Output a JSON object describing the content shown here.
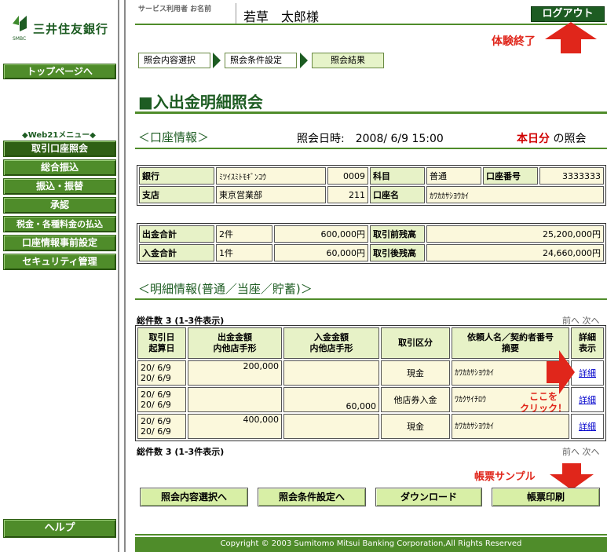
{
  "bank": {
    "name": "三井住友銀行",
    "abbr": "SMBC"
  },
  "nav": {
    "top_page": "トップページへ",
    "menu_title": "◆Web21メニュー◆",
    "items": [
      "取引口座照会",
      "総合振込",
      "振込・振替",
      "承認",
      "税金・各種料金の払込",
      "口座情報事前設定",
      "セキュリティ管理"
    ],
    "help": "ヘルプ"
  },
  "header": {
    "user_label": "サービス利用者 お名前",
    "user_name": "若草　太郎様",
    "logout": "ログアウト"
  },
  "annotations": {
    "end": "体験終了",
    "click_here": "ここを\nクリック！",
    "sample": "帳票サンプル"
  },
  "breadcrumb": [
    "照会内容選択",
    "照会条件設定",
    "照会結果"
  ],
  "page_title": "■入出金明細照会",
  "account": {
    "heading": "＜口座情報＞",
    "inquiry_date": "照会日時:　2008/ 6/9 15:00",
    "today_prefix": "本日分",
    "today_suffix": " の照会",
    "bank_label": "銀行",
    "bank_value": "ﾐﾂｲｽﾐﾄﾓｷﾞﾝｺｳ",
    "bank_code": "0009",
    "subject_label": "科目",
    "subject_value": "普通",
    "acct_no_label": "口座番号",
    "acct_no_value": "3333333",
    "branch_label": "支店",
    "branch_value": "東京営業部",
    "branch_code": "211",
    "acct_name_label": "口座名",
    "acct_name_value": "ｶﾜｶｶｻｼﾖｳｶｲ"
  },
  "summary": {
    "out_label": "出金合計",
    "out_count": "2件",
    "out_amount": "600,000円",
    "before_label": "取引前残高",
    "before_value": "25,200,000円",
    "in_label": "入金合計",
    "in_count": "1件",
    "in_amount": "60,000円",
    "after_label": "取引後残高",
    "after_value": "24,660,000円"
  },
  "detail": {
    "heading": "＜明細情報(普通／当座／貯蓄)＞",
    "count": "総件数 3 (1-3件表示)",
    "nav": "前へ 次へ",
    "headers": [
      "取引日\n起算日",
      "出金金額\n内他店手形",
      "入金金額\n内他店手形",
      "取引区分",
      "依頼人名／契約者番号\n摘要",
      "詳細\n表示"
    ],
    "rows": [
      {
        "date": "20/ 6/9\n20/ 6/9",
        "out": "200,000",
        "in": "",
        "type": "現金",
        "name": "ｶﾜｶｶｻｼﾖｳｶｲ",
        "detail": "詳細"
      },
      {
        "date": "20/ 6/9\n20/ 6/9",
        "out": "",
        "in": "60,000",
        "type": "他店券入金",
        "name": "ﾜｶｸｻｲﾁﾛｳ",
        "detail": "詳細"
      },
      {
        "date": "20/ 6/9\n20/ 6/9",
        "out": "400,000",
        "in": "",
        "type": "現金",
        "name": "ｶﾜｶｶｻｼﾖｳｶｲ",
        "detail": "詳細"
      }
    ]
  },
  "buttons": {
    "select": "照会内容選択へ",
    "condition": "照会条件設定へ",
    "download": "ダウンロード",
    "print": "帳票印刷"
  },
  "footer": "Copyright © 2003 Sumitomo Mitsui Banking Corporation,All Rights Reserved",
  "colors": {
    "brand_green": "#4f8c2a",
    "dark_green": "#1d5c22",
    "annotation_red": "#e0261b"
  }
}
